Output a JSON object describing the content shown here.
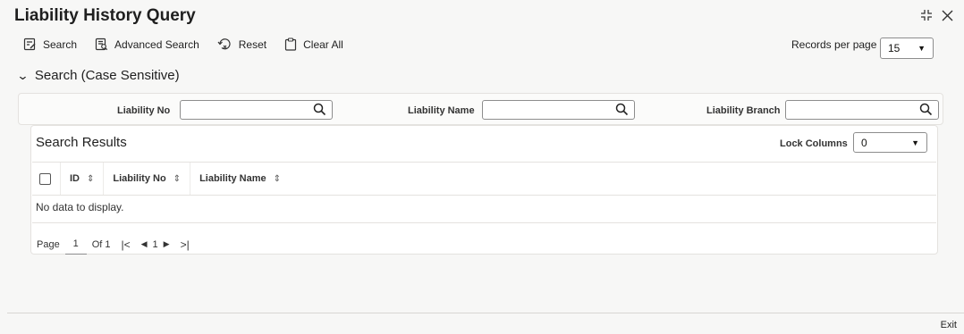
{
  "window": {
    "title": "Liability History Query",
    "collapse_icon": "collapse-icon",
    "close_icon": "close-icon"
  },
  "toolbar": {
    "search_label": "Search",
    "advanced_search_label": "Advanced Search",
    "reset_label": "Reset",
    "clear_all_label": "Clear All",
    "records_per_page_label": "Records per page",
    "records_per_page_value": "15"
  },
  "search_section": {
    "title": "Search (Case Sensitive)",
    "fields": [
      {
        "label": "Liability No",
        "value": ""
      },
      {
        "label": "Liability Name",
        "value": ""
      },
      {
        "label": "Liability Branch",
        "value": ""
      }
    ]
  },
  "results": {
    "title": "Search Results",
    "lock_columns_label": "Lock Columns",
    "lock_columns_value": "0",
    "columns": [
      "ID",
      "Liability No",
      "Liability Name"
    ],
    "empty_message": "No data to display.",
    "pager": {
      "page_label": "Page",
      "current_page": "1",
      "of_label": "Of 1",
      "page_indicator": "1"
    }
  },
  "footer": {
    "exit_label": "Exit"
  }
}
